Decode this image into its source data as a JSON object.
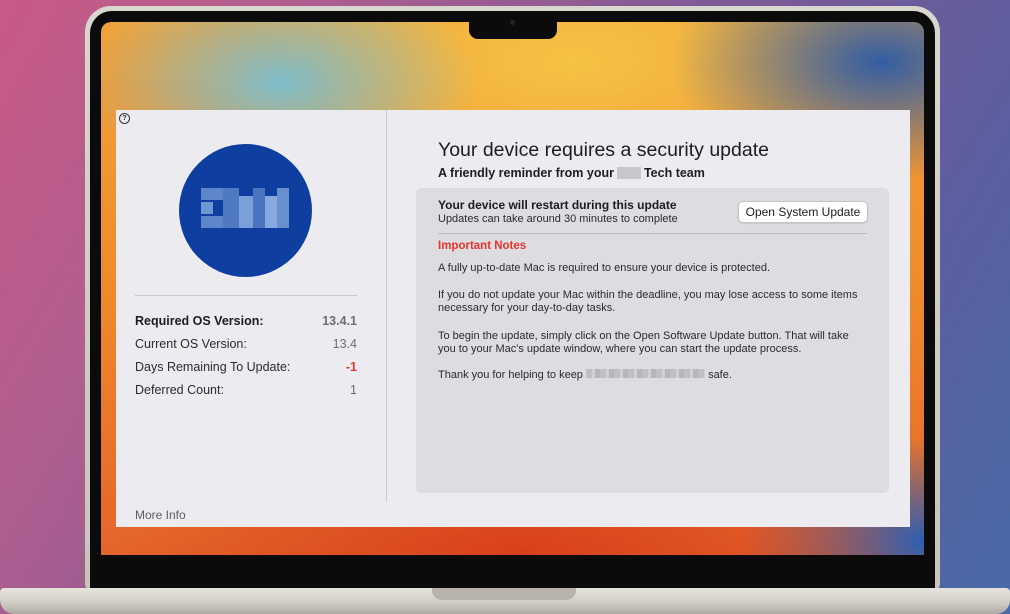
{
  "help": {
    "icon": "question-circle-icon",
    "glyph": "?"
  },
  "left": {
    "rows": [
      {
        "label": "Required OS Version:",
        "value": "13.4.1"
      },
      {
        "label": "Current OS Version:",
        "value": "13.4"
      },
      {
        "label": "Days Remaining To Update:",
        "value": "-1"
      },
      {
        "label": "Deferred Count:",
        "value": "1"
      }
    ],
    "more_info": "More Info"
  },
  "right": {
    "title": "Your device requires a security update",
    "subtitle_prefix": "A friendly reminder from your",
    "subtitle_suffix": "Tech team",
    "restart_title": "Your device will restart during this update",
    "restart_sub": "Updates can take around 30 minutes to complete",
    "button_label": "Open System Update",
    "notes_heading": "Important Notes",
    "notes": [
      "A fully up-to-date Mac is required to ensure your device is protected.",
      "If you do not update your Mac within the deadline, you may lose access to some items necessary for your day-to-day tasks.",
      "To begin the update, simply click on the Open Software Update button. That will take you to your Mac's update window, where you can start the update process."
    ],
    "thanks_prefix": "Thank you for helping to keep",
    "thanks_suffix": "safe."
  },
  "colors": {
    "accent_alert": "#e8342b",
    "logo_blue": "#0e3fa0"
  }
}
